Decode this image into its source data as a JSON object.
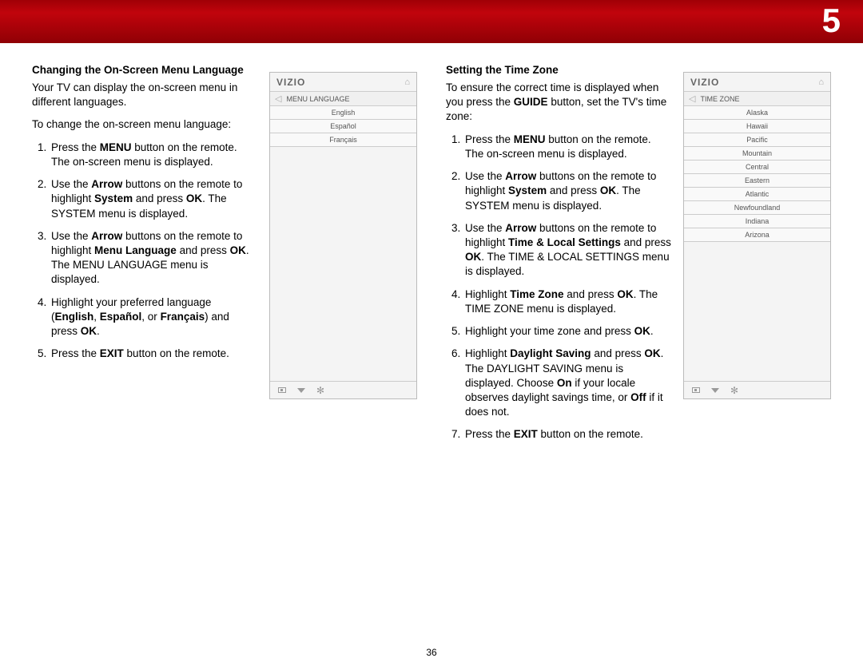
{
  "chapter": "5",
  "page_number": "36",
  "left": {
    "heading": "Changing the On-Screen Menu Language",
    "intro1": "Your TV can display the on-screen menu in different languages.",
    "intro2": "To change the on-screen menu language:",
    "steps": {
      "s1a": "Press the ",
      "s1b": "MENU",
      "s1c": " button on the remote. The on-screen menu is displayed.",
      "s2a": "Use the ",
      "s2b": "Arrow",
      "s2c": " buttons on the remote to highlight ",
      "s2d": "System",
      "s2e": " and press ",
      "s2f": "OK",
      "s2g": ". The SYSTEM menu is displayed.",
      "s3a": "Use the ",
      "s3b": "Arrow",
      "s3c": " buttons on the remote to highlight ",
      "s3d": "Menu Language",
      "s3e": " and press ",
      "s3f": "OK",
      "s3g": ". The MENU LANGUAGE menu is displayed.",
      "s4a": "Highlight your preferred language (",
      "s4b": "English",
      "s4c": ", ",
      "s4d": "Español",
      "s4e": ", or ",
      "s4f": "Français",
      "s4g": ") and press ",
      "s4h": "OK",
      "s4i": ".",
      "s5a": "Press the ",
      "s5b": "EXIT",
      "s5c": " button on the remote."
    },
    "menu": {
      "logo": "VIZIO",
      "title": "MENU LANGUAGE",
      "items": [
        "English",
        "Español",
        "Français"
      ]
    }
  },
  "right": {
    "heading": "Setting the Time Zone",
    "intro1a": "To ensure the correct time is displayed when you press the ",
    "intro1b": "GUIDE",
    "intro1c": " button, set the TV's time zone:",
    "steps": {
      "s1a": "Press the ",
      "s1b": "MENU",
      "s1c": " button on the remote. The on-screen menu is displayed.",
      "s2a": "Use the ",
      "s2b": "Arrow",
      "s2c": " buttons on the remote to highlight ",
      "s2d": "System",
      "s2e": " and press ",
      "s2f": "OK",
      "s2g": ". The SYSTEM menu is displayed.",
      "s3a": "Use the ",
      "s3b": "Arrow",
      "s3c": " buttons on the remote to highlight ",
      "s3d": "Time & Local Settings",
      "s3e": " and press ",
      "s3f": "OK",
      "s3g": ". The TIME & LOCAL SETTINGS menu is displayed.",
      "s4a": "Highlight ",
      "s4b": "Time Zone",
      "s4c": " and press ",
      "s4d": "OK",
      "s4e": ". The TIME ZONE menu is displayed.",
      "s5a": "Highlight your time zone and press ",
      "s5b": "OK",
      "s5c": ".",
      "s6a": "Highlight ",
      "s6b": "Daylight Saving",
      "s6c": " and press ",
      "s6d": "OK",
      "s6e": ". The DAYLIGHT SAVING menu is displayed. Choose ",
      "s6f": "On",
      "s6g": " if your locale observes daylight savings time, or ",
      "s6h": "Off",
      "s6i": " if it does not.",
      "s7a": "Press the ",
      "s7b": "EXIT",
      "s7c": " button on the remote."
    },
    "menu": {
      "logo": "VIZIO",
      "title": "TIME ZONE",
      "items": [
        "Alaska",
        "Hawaii",
        "Pacific",
        "Mountain",
        "Central",
        "Eastern",
        "Atlantic",
        "Newfoundland",
        "Indiana",
        "Arizona"
      ]
    }
  }
}
